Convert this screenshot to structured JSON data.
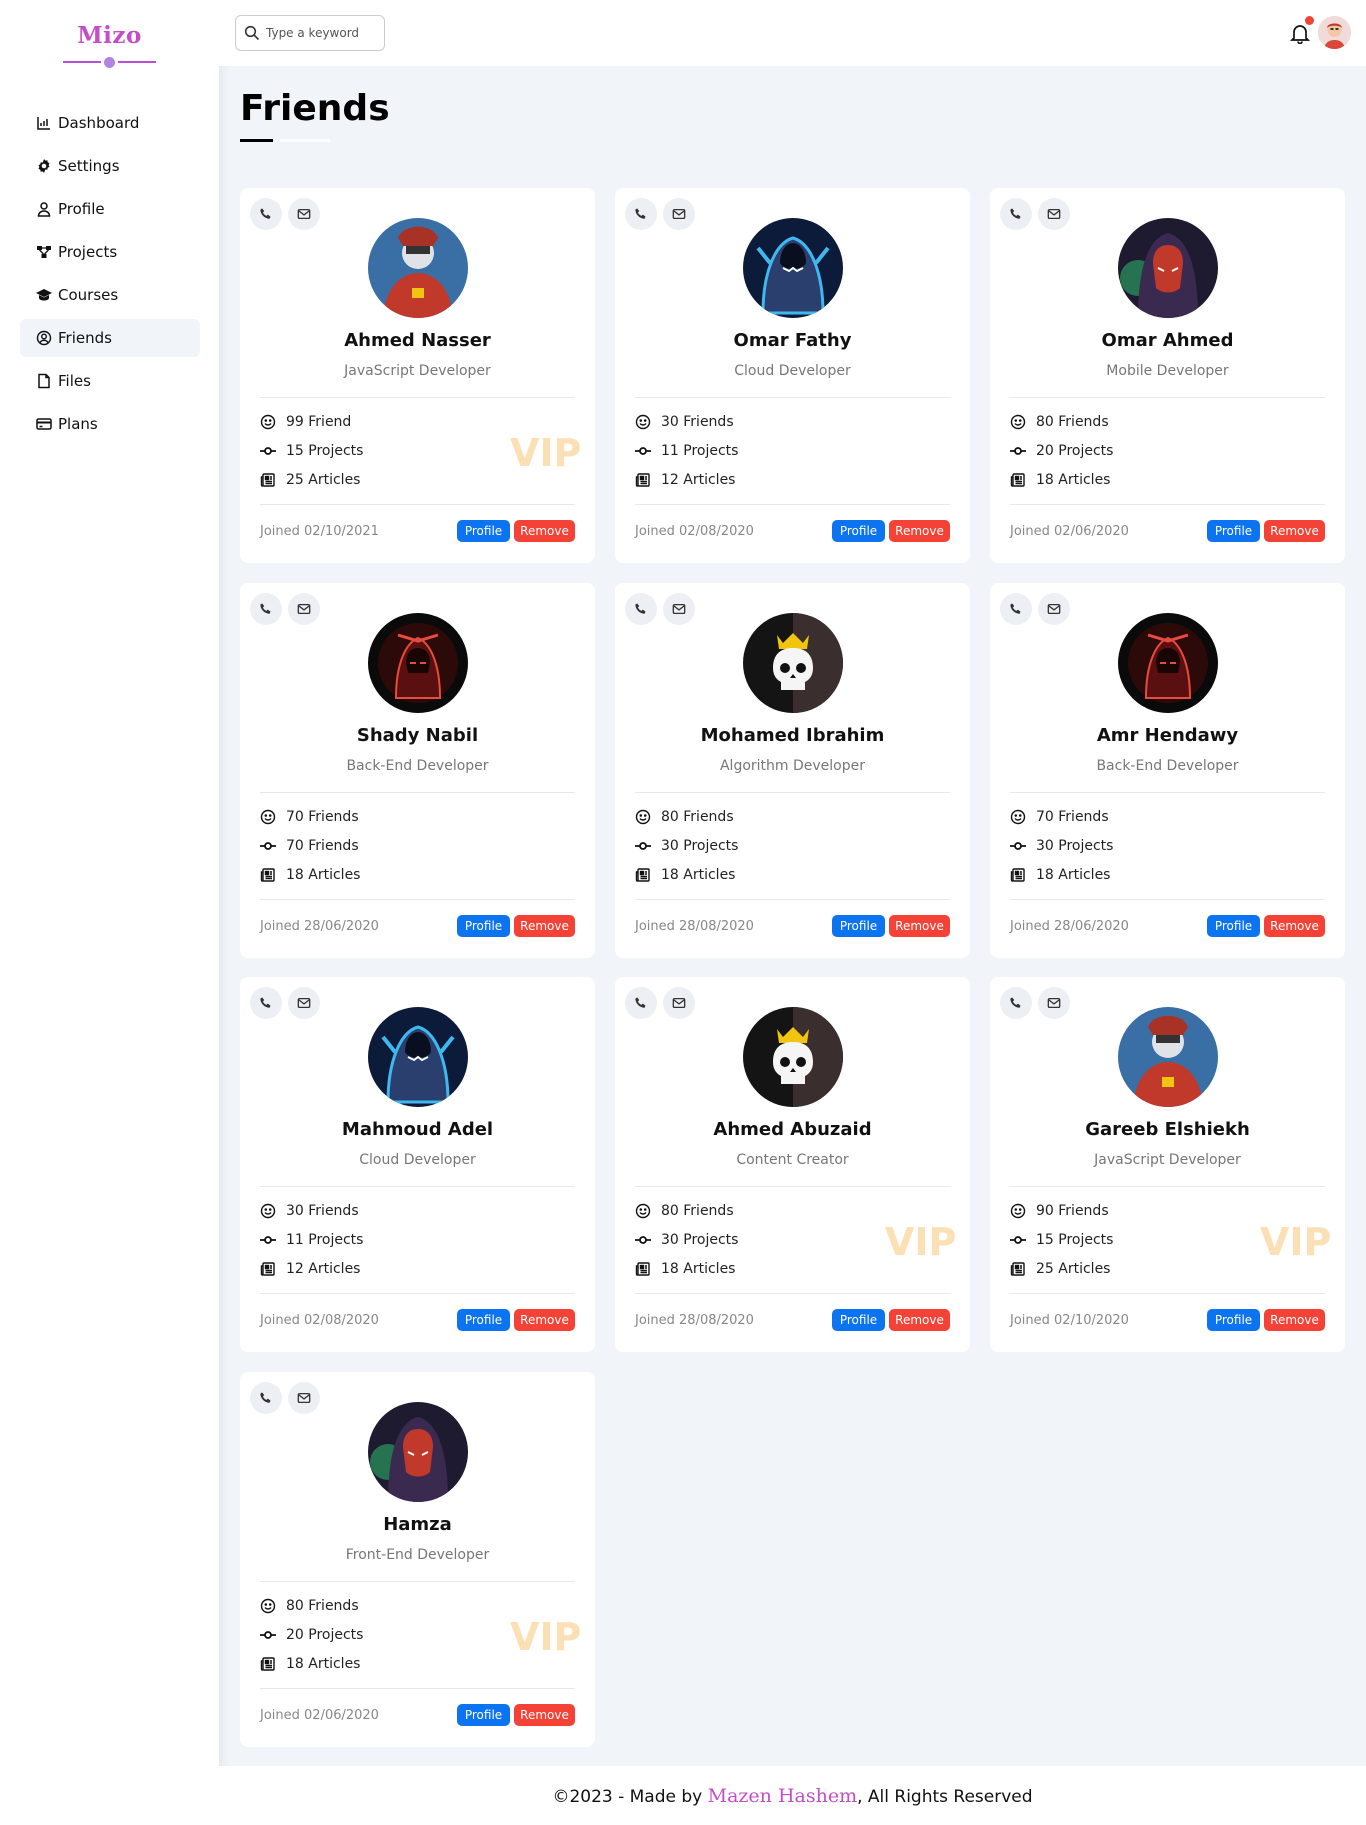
{
  "app": {
    "logo": "Mizo"
  },
  "sidebar": {
    "items": [
      {
        "label": "Dashboard",
        "icon": "chart-icon",
        "active": false
      },
      {
        "label": "Settings",
        "icon": "gear-icon",
        "active": false
      },
      {
        "label": "Profile",
        "icon": "user-icon",
        "active": false
      },
      {
        "label": "Projects",
        "icon": "diagram-icon",
        "active": false
      },
      {
        "label": "Courses",
        "icon": "graduation-cap-icon",
        "active": false
      },
      {
        "label": "Friends",
        "icon": "user-circle-icon",
        "active": true
      },
      {
        "label": "Files",
        "icon": "file-icon",
        "active": false
      },
      {
        "label": "Plans",
        "icon": "credit-card-icon",
        "active": false
      }
    ]
  },
  "header": {
    "search_placeholder": "Type a keyword",
    "notifications_icon": "bell-icon",
    "avatar_icon": "avatar"
  },
  "page": {
    "title": "Friends"
  },
  "colors": {
    "profile_button": "#0c74f0",
    "remove_button": "#f44336",
    "vip": "#fbdfb5",
    "brand": "#c44ec9"
  },
  "friends": [
    {
      "name": "Ahmed Nasser",
      "role": "JavaScript Developer",
      "stat1": "99 Friend",
      "stat2": "15 Projects",
      "stat3": "25 Articles",
      "vip": "VIP",
      "joined": "Joined 02/10/2021",
      "profile": "Profile",
      "remove": "Remove",
      "avatar": "red-hooded-character"
    },
    {
      "name": "Omar Fathy",
      "role": "Cloud Developer",
      "stat1": "30 Friends",
      "stat2": "11 Projects",
      "stat3": "12 Articles",
      "vip": "",
      "joined": "Joined 02/08/2020",
      "profile": "Profile",
      "remove": "Remove",
      "avatar": "blue-hooded-assassin"
    },
    {
      "name": "Omar Ahmed",
      "role": "Mobile Developer",
      "stat1": "80 Friends",
      "stat2": "20 Projects",
      "stat3": "18 Articles",
      "vip": "",
      "joined": "Joined 02/06/2020",
      "profile": "Profile",
      "remove": "Remove",
      "avatar": "red-masked-hood"
    },
    {
      "name": "Shady Nabil",
      "role": "Back-End Developer",
      "stat1": "70 Friends",
      "stat2": "70 Friends",
      "stat3": "18 Articles",
      "vip": "",
      "joined": "Joined 28/06/2020",
      "profile": "Profile",
      "remove": "Remove",
      "avatar": "dark-red-warrior"
    },
    {
      "name": "Mohamed Ibrahim",
      "role": "Algorithm Developer",
      "stat1": "80 Friends",
      "stat2": "30 Projects",
      "stat3": "18 Articles",
      "vip": "",
      "joined": "Joined 28/08/2020",
      "profile": "Profile",
      "remove": "Remove",
      "avatar": "crowned-skull"
    },
    {
      "name": "Amr Hendawy",
      "role": "Back-End Developer",
      "stat1": "70 Friends",
      "stat2": "30 Projects",
      "stat3": "18 Articles",
      "vip": "",
      "joined": "Joined 28/06/2020",
      "profile": "Profile",
      "remove": "Remove",
      "avatar": "dark-red-warrior"
    },
    {
      "name": "Mahmoud Adel",
      "role": "Cloud Developer",
      "stat1": "30 Friends",
      "stat2": "11 Projects",
      "stat3": "12 Articles",
      "vip": "",
      "joined": "Joined 02/08/2020",
      "profile": "Profile",
      "remove": "Remove",
      "avatar": "blue-hooded-assassin"
    },
    {
      "name": "Ahmed Abuzaid",
      "role": "Content Creator",
      "stat1": "80 Friends",
      "stat2": "30 Projects",
      "stat3": "18 Articles",
      "vip": "VIP",
      "joined": "Joined 28/08/2020",
      "profile": "Profile",
      "remove": "Remove",
      "avatar": "crowned-skull"
    },
    {
      "name": "Gareeb Elshiekh",
      "role": "JavaScript Developer",
      "stat1": "90 Friends",
      "stat2": "15 Projects",
      "stat3": "25 Articles",
      "vip": "VIP",
      "joined": "Joined 02/10/2020",
      "profile": "Profile",
      "remove": "Remove",
      "avatar": "red-hooded-character"
    },
    {
      "name": "Hamza",
      "role": "Front-End Developer",
      "stat1": "80 Friends",
      "stat2": "20 Projects",
      "stat3": "18 Articles",
      "vip": "VIP",
      "joined": "Joined 02/06/2020",
      "profile": "Profile",
      "remove": "Remove",
      "avatar": "red-masked-hood"
    }
  ],
  "footer": {
    "prefix": "©2023 - Made by ",
    "author": "Mazen Hashem",
    "suffix": ", All Rights Reserved"
  }
}
